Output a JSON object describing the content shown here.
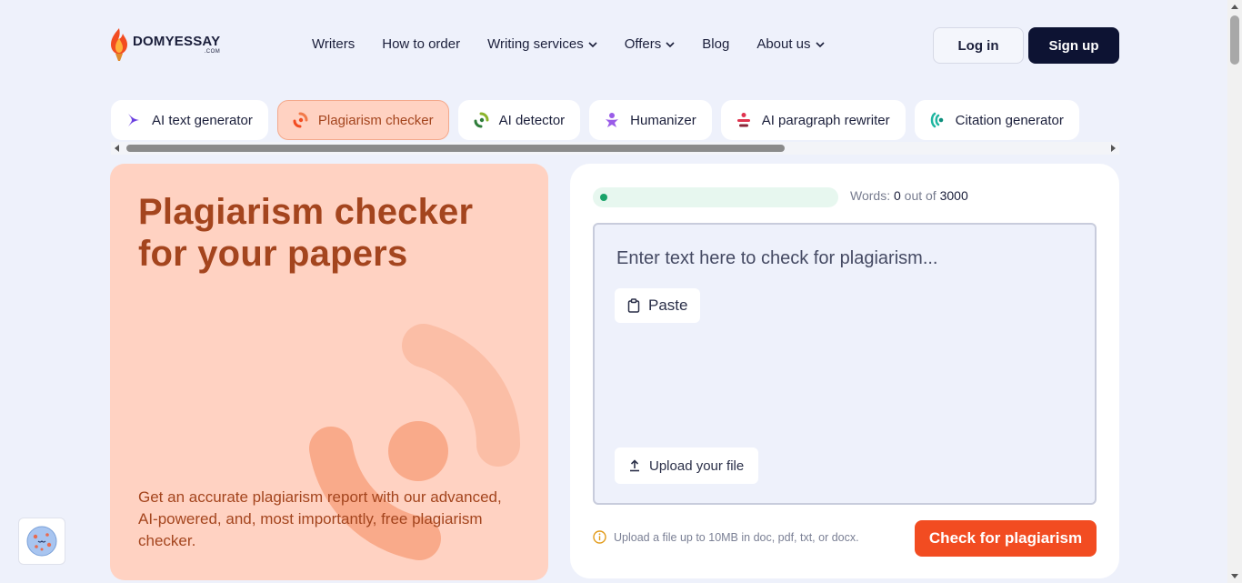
{
  "brand": {
    "name": "DOMYESSAY",
    "suffix": ".COM",
    "accent": "#f24c21",
    "dark": "#0d1333"
  },
  "nav": {
    "items": [
      {
        "label": "Writers",
        "has_dropdown": false
      },
      {
        "label": "How to order",
        "has_dropdown": false
      },
      {
        "label": "Writing services",
        "has_dropdown": true
      },
      {
        "label": "Offers",
        "has_dropdown": true
      },
      {
        "label": "Blog",
        "has_dropdown": false
      },
      {
        "label": "About us",
        "has_dropdown": true
      }
    ],
    "login_label": "Log in",
    "signup_label": "Sign up"
  },
  "tools": {
    "tabs": [
      {
        "label": "AI text generator",
        "icon": "sparkle-icon",
        "active": false
      },
      {
        "label": "Plagiarism checker",
        "icon": "plagiarism-icon",
        "active": true
      },
      {
        "label": "AI detector",
        "icon": "detector-icon",
        "active": false
      },
      {
        "label": "Humanizer",
        "icon": "humanizer-icon",
        "active": false
      },
      {
        "label": "AI paragraph rewriter",
        "icon": "rewriter-icon",
        "active": false
      },
      {
        "label": "Citation generator",
        "icon": "citation-icon",
        "active": false
      }
    ]
  },
  "hero": {
    "title": "Plagiarism checker for your papers",
    "description": "Get an accurate plagiarism report with our advanced, AI-powered, and, most importantly, free plagiarism checker.",
    "bg_color": "#ffd2c2",
    "text_color": "#a4451e"
  },
  "checker": {
    "words_label": "Words:",
    "words_count": "0",
    "words_out_of": "out of",
    "words_max": "3000",
    "word_fill": 0,
    "placeholder": "Enter text here to check for plagiarism...",
    "paste_label": "Paste",
    "upload_label": "Upload your file",
    "note": "Upload a file up to 10MB in doc, pdf, txt, or docx.",
    "submit_label": "Check for plagiarism"
  }
}
